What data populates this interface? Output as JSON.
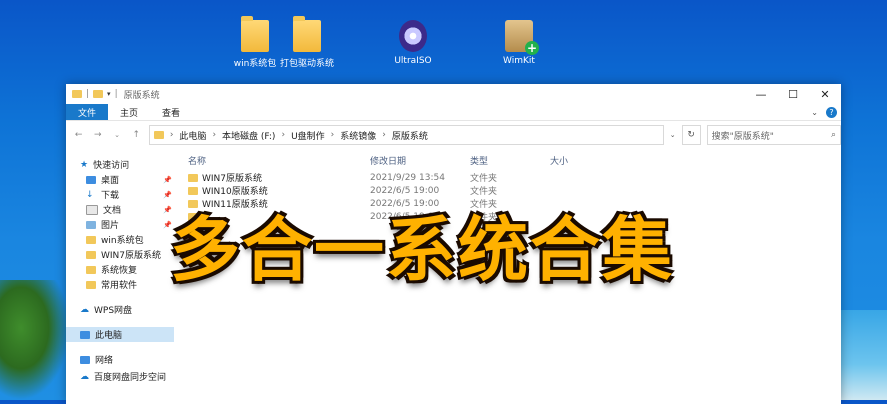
{
  "desktop": {
    "icons": [
      {
        "label": "win系统包",
        "icon": "app-icon"
      },
      {
        "label": "打包驱动系统",
        "icon": "folder-icon"
      },
      {
        "label": "UltraISO",
        "icon": "disc-icon"
      },
      {
        "label": "WimKit",
        "icon": "package-icon"
      }
    ]
  },
  "window": {
    "title": "原版系统",
    "controls": {
      "minimize": "—",
      "maximize": "☐",
      "close": "✕"
    },
    "ribbon_tabs": [
      "文件",
      "主页",
      "查看"
    ],
    "address": {
      "segments": [
        "此电脑",
        "本地磁盘 (F:)",
        "U盘制作",
        "系统镜像",
        "原版系统"
      ],
      "refresh": "↻"
    },
    "search": {
      "placeholder": "搜索\"原版系统\""
    },
    "sidebar": {
      "quick_access": "快速访问",
      "items": [
        "桌面",
        "下载",
        "文档",
        "图片",
        "win系统包",
        "WIN7原版系统",
        "系统恢复",
        "常用软件"
      ],
      "wps": "WPS网盘",
      "this_pc": "此电脑",
      "network": "网络",
      "baidu": "百度网盘同步空间"
    },
    "columns": [
      "名称",
      "修改日期",
      "类型",
      "大小"
    ],
    "files": [
      {
        "name": "WIN7原版系统",
        "date": "2021/9/29 13:54",
        "type": "文件夹"
      },
      {
        "name": "WIN10原版系统",
        "date": "2022/6/5 19:00",
        "type": "文件夹"
      },
      {
        "name": "WIN11原版系统",
        "date": "2022/6/5 19:00",
        "type": "文件夹"
      },
      {
        "name": "",
        "date": "2022/6/5 19:00",
        "type": "文件夹"
      }
    ]
  },
  "overlay": {
    "text": "多合一系统合集"
  },
  "colors": {
    "accent": "#1979ca",
    "overlay_text": "#ffb100",
    "folder": "#f2c85a"
  }
}
